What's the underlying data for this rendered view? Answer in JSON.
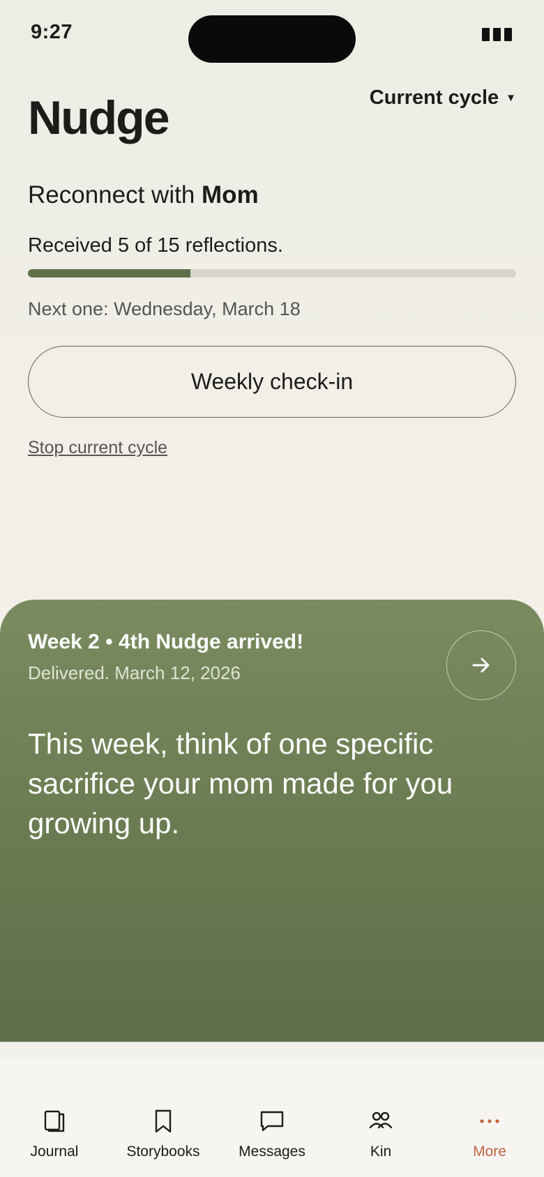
{
  "status": {
    "time": "9:27"
  },
  "header": {
    "title": "Nudge",
    "cycle_select": "Current cycle"
  },
  "relationship": {
    "prefix": "Reconnect with ",
    "name": "Mom"
  },
  "progress": {
    "text": "Received 5 of 15 reflections.",
    "received": 5,
    "total": 15,
    "fraction": 0.333
  },
  "next_one": "Next one: Wednesday, March 18",
  "checkin_button": "Weekly check-in",
  "stop_link": "Stop current cycle",
  "nudge_card": {
    "heading": "Week 2 • 4th Nudge arrived!",
    "delivered": "Delivered. March 12, 2026",
    "prompt": "This week, think of one specific sacrifice your mom made for you growing up."
  },
  "tabs": [
    {
      "label": "Journal",
      "icon": "journal-icon"
    },
    {
      "label": "Storybooks",
      "icon": "bookmark-icon"
    },
    {
      "label": "Messages",
      "icon": "message-icon"
    },
    {
      "label": "Kin",
      "icon": "people-icon"
    },
    {
      "label": "More",
      "icon": "more-dots-icon",
      "active": true
    }
  ],
  "colors": {
    "accent": "#5f7148",
    "card": "#6b7c52",
    "active_tab": "#c2643f"
  }
}
